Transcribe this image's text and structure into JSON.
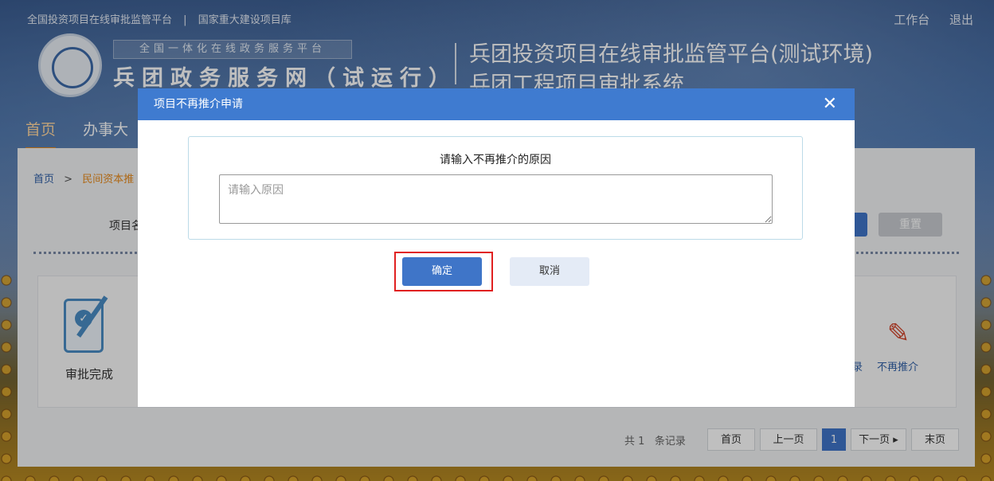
{
  "header": {
    "top_links": [
      "全国投资项目在线审批监管平台",
      "|",
      "国家重大建设项目库"
    ],
    "workbench": "工作台",
    "logout": "退出",
    "slogan": "全国一体化在线政务服务平台",
    "site_name": "兵团政务服务网（试运行）",
    "platform_title": "兵团投资项目在线审批监管平台(测试环境)",
    "system_title": "兵团工程项目审批系统"
  },
  "nav": {
    "items": [
      "首页",
      "办事大"
    ]
  },
  "page": {
    "breadcrumb": [
      "首页",
      ">",
      "民间资本推"
    ],
    "filter_label": "项目名",
    "reset_label": "重置",
    "status_done": "审批完成",
    "action_no_recommend": "不再推介",
    "action_cut": "录"
  },
  "pagination": {
    "total_prefix": "共 1",
    "total_suffix": "条记录",
    "first": "首页",
    "prev": "上一页",
    "current": "1",
    "next": "下一页 ▸",
    "last": "末页"
  },
  "modal": {
    "title": "项目不再推介申请",
    "form_title": "请输入不再推介的原因",
    "reason_placeholder": "请输入原因",
    "reason_value": "",
    "confirm_label": "确定",
    "cancel_label": "取消"
  },
  "colors": {
    "modal_header": "#3f7bd0",
    "primary_button": "#3f75c8",
    "highlight_border": "#e02020",
    "accent_orange": "#e88a1a"
  }
}
